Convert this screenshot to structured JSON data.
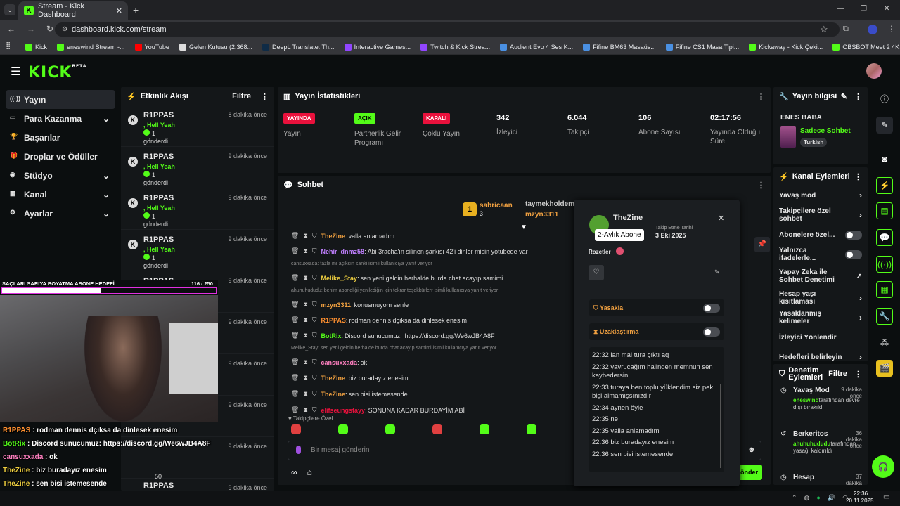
{
  "browser": {
    "tab_title": "Stream - Kick Dashboard",
    "url": "dashboard.kick.com/stream",
    "bookmarks": [
      "Kick",
      "eneswind Stream -...",
      "YouTube",
      "Gelen Kutusu (2.368...",
      "DeepL Translate: Th...",
      "Interactive Games...",
      "Twitch & Kick Strea...",
      "Audient Evo 4 Ses K...",
      "Fifine BM63 Masaüs...",
      "Fifine CS1 Masa Tipi...",
      "Kickaway - Kick Çeki...",
      "OBSBOT Meet 2 4K..."
    ],
    "all_bookmarks": "All Bookmarks"
  },
  "logo": {
    "text": "KICK",
    "beta": "BETA"
  },
  "nav": [
    "Yayın",
    "Para Kazanma",
    "Başarılar",
    "Droplar ve Ödüller",
    "Stüdyo",
    "Kanal",
    "Ayarlar"
  ],
  "feed": {
    "title": "Etkinlik Akışı",
    "filter": "Filtre",
    "items": [
      {
        "user": "R1PPAS",
        "msg": ", Hell Yeah",
        "qty": "1",
        "sent": "gönderdi",
        "time": "8 dakika önce"
      },
      {
        "user": "R1PPAS",
        "msg": ", Hell Yeah",
        "qty": "1",
        "sent": "gönderdi",
        "time": "9 dakika önce"
      },
      {
        "user": "R1PPAS",
        "msg": ", Hell Yeah",
        "qty": "1",
        "sent": "gönderdi",
        "time": "9 dakika önce"
      },
      {
        "user": "R1PPAS",
        "msg": ", Hell Yeah",
        "qty": "1",
        "sent": "gönderdi",
        "time": "9 dakika önce"
      },
      {
        "user": "R1PPAS",
        "msg": ", Hype",
        "qty": "",
        "sent": "",
        "time": "9 dakika önce"
      }
    ],
    "times_more": [
      "9 dakika önce",
      "9 dakika önce",
      "9 dakika önce",
      "9 dakika önce"
    ],
    "last": {
      "user": "R1PPAS",
      "msg": ", Full Send",
      "qty": "100",
      "sent": "gönderdi",
      "time": "9 dakika önce",
      "hidden_qty": "50"
    }
  },
  "stats": {
    "title": "Yayın İstatistikleri",
    "items": [
      {
        "badge": "YAYINDA",
        "label": "Yayın",
        "color": "#e9113c",
        "fg": "#fff"
      },
      {
        "badge": "AÇIK",
        "label": "Partnerlik Gelir Programı",
        "color": "#53fc18",
        "fg": "#000"
      },
      {
        "badge": "KAPALI",
        "label": "Çoklu Yayın",
        "color": "#e9113c",
        "fg": "#fff"
      },
      {
        "value": "342",
        "label": "İzleyici"
      },
      {
        "value": "6.044",
        "label": "Takipçi"
      },
      {
        "value": "106",
        "label": "Abone Sayısı"
      },
      {
        "value": "02:17:56",
        "label": "Yayında Olduğu Süre"
      }
    ]
  },
  "chat": {
    "title": "Sohbet",
    "top_user1": "sabricaan",
    "top_count": "3",
    "top_user2": "taymekholdem",
    "top_user3": "mzyn3311",
    "messages": [
      {
        "user": "TheZine",
        "color": "#f0a040",
        "text": "valla anlamadım"
      },
      {
        "user": "Nehir_dnmz58",
        "color": "#c080ff",
        "text": "Abi 3racha'ın silinen şarkısı 42'i dinler misin yotubede var"
      },
      {
        "sys": "cansuxxada: fazla mı açıksın sanki isimli kullanıcıya yanıt veriyor"
      },
      {
        "user": "Melike_Stay",
        "color": "#f0d040",
        "text": "sen yeni geldin herhalde burda chat acayıp samimi"
      },
      {
        "sys": "ahuhuhududu: benim aboneliği yenilediğin için tekrar teşekkürlerr isimli kullanıcıya yanıt veriyor"
      },
      {
        "user": "mzyn3311",
        "color": "#f0a040",
        "text": "konusmuyom senle"
      },
      {
        "user": "R1PPAS",
        "color": "#ff9030",
        "text": "rodman dennis dçıksa da dinlesek enesim"
      },
      {
        "user": "BotRix",
        "color": "#53fc18",
        "text": "Discord sunucumuz:",
        "link": "https://discord.gg/We6wJB4A8F"
      },
      {
        "sys": "Melike_Stay: sen yeni geldin herhalde burda chat acayıp samimi isimli kullanıcıya yanıt veriyor"
      },
      {
        "user": "cansuxxada",
        "color": "#ff80c0",
        "text": "ok"
      },
      {
        "user": "TheZine",
        "color": "#f0a040",
        "text": "biz buradayız enesim"
      },
      {
        "user": "TheZine",
        "color": "#f0a040",
        "text": "sen bisi istemesende"
      },
      {
        "user": "elifseungstayy",
        "color": "#e9113c",
        "text": "SONUNA KADAR BURDAYİM ABİ"
      }
    ],
    "followers_only": "Takipçilere Özel",
    "placeholder": "Bir mesaj gönderin",
    "send": "Gönder"
  },
  "modal": {
    "user": "TheZine",
    "tooltip": "2-Aylık Abone",
    "follow_label": "Takip Etme Tarihi",
    "follow_date": "3 Eki 2025",
    "badges": "Rozetler",
    "ban": "Yasakla",
    "timeout": "Uzaklaştırma",
    "log": [
      {
        "t": "22:32",
        "m": "lan mal tura çıktı aq"
      },
      {
        "t": "22:32",
        "m": "yavrucağım halinden memnun sen kaybedersin"
      },
      {
        "t": "22:33",
        "m": "turaya ben toplu yüklendim siz pek bişi almamışsınızdır"
      },
      {
        "t": "22:34",
        "m": "aynen öyle"
      },
      {
        "t": "22:35",
        "m": "ne"
      },
      {
        "t": "22:35",
        "m": "valla anlamadım"
      },
      {
        "t": "22:36",
        "m": "biz buradayız enesim"
      },
      {
        "t": "22:36",
        "m": "sen bisi istemesende"
      }
    ]
  },
  "info": {
    "title": "Yayın bilgisi",
    "name": "ENES BABA",
    "category": "Sadece Sohbet",
    "lang": "Turkish"
  },
  "actions": {
    "title": "Kanal Eylemleri",
    "items": [
      "Yavaş mod",
      "Takipçilere özel sohbet",
      "Abonelere özel...",
      "Yalnızca ifadelerle...",
      "Yapay Zeka ile Sohbet Denetimi",
      "Hesap yaşı kısıtlaması",
      "Yasaklanmış kelimeler",
      "İzleyici Yönlendir",
      "Hedefleri belirleyin"
    ]
  },
  "modlog": {
    "title": "Denetim Eylemleri",
    "filter": "Filtre",
    "items": [
      {
        "title": "Yavaş Mod",
        "time": "9 dakika önce",
        "who": "eneswind",
        "desc": "tarafından devre dışı bırakıldı"
      },
      {
        "title": "Berkeritos",
        "time": "36 dakika önce",
        "who": "ahuhuhududu",
        "desc": "tarafından yasağı kaldırıldı"
      },
      {
        "title": "Hesap",
        "time": "37 dakika önce"
      }
    ]
  },
  "overlay": {
    "goal": "SAÇLARI SARIYA BOYATMA ABONE HEDEFİ",
    "goal_count": "116 / 250",
    "goal_fraction": 0.464,
    "lines": [
      {
        "user": "R1PPAS",
        "color": "#ff9030",
        "text": "rodman dennis dçıksa da dinlesek enesim"
      },
      {
        "user": "BotRix",
        "color": "#53fc18",
        "text": "Discord sunucumuz: https://discord.gg/We6wJB4A8F"
      },
      {
        "user": "cansuxxada",
        "color": "#ff80c0",
        "text": "ok"
      },
      {
        "user": "TheZine",
        "color": "#f0d040",
        "text": "biz buradayız enesim"
      },
      {
        "user": "TheZine",
        "color": "#f0d040",
        "text": "sen bisi istemesende"
      },
      {
        "user": "elifseungstayy",
        "color": "#e9113c",
        "text": "SONUNA KADAR BURDAYİM ABİ"
      }
    ]
  },
  "clock": {
    "time": "22:36",
    "date": "20.11.2025"
  }
}
